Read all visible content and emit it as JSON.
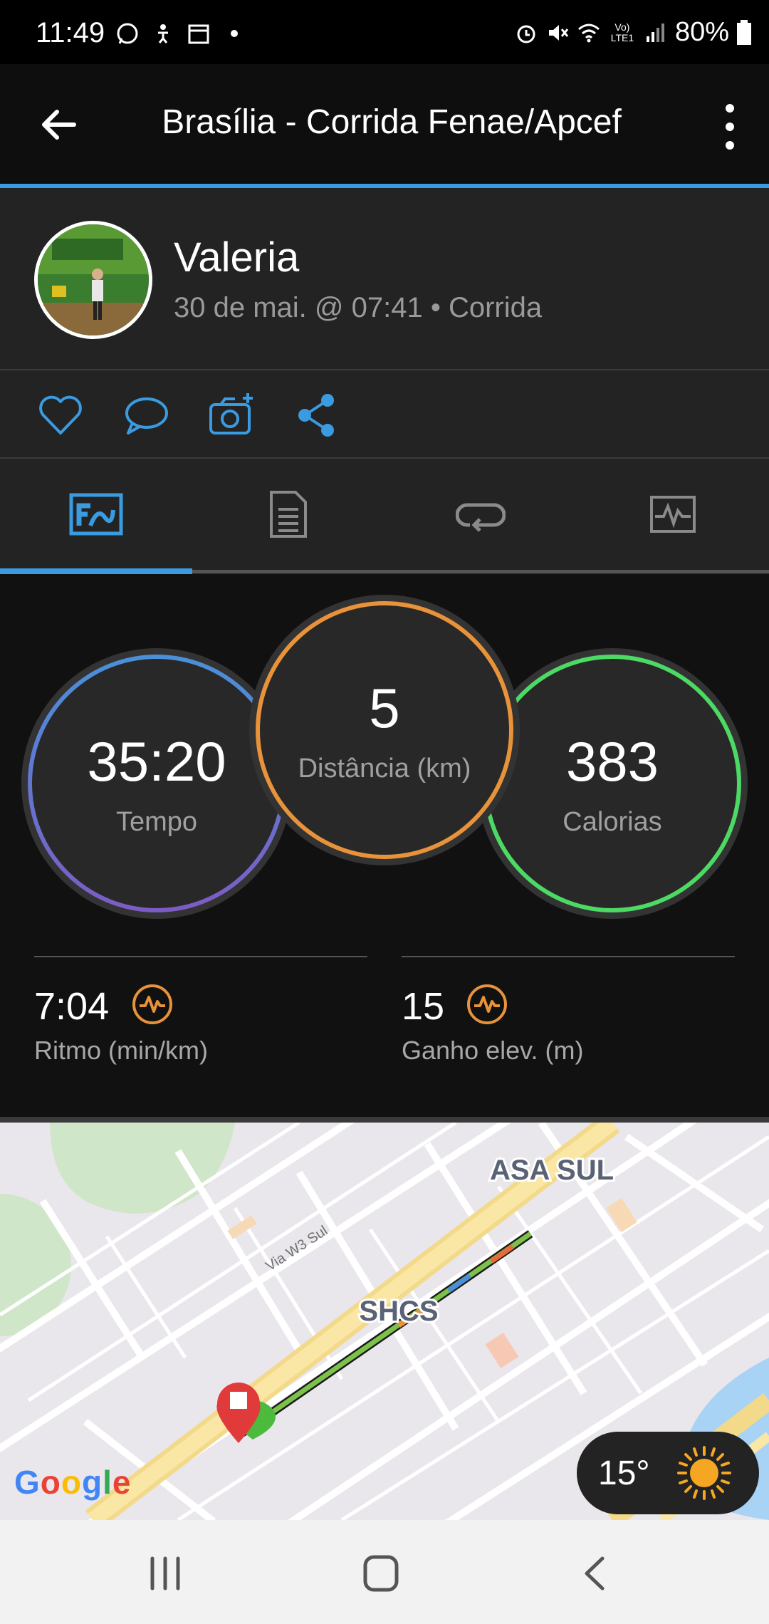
{
  "status_bar": {
    "time": "11:49",
    "battery": "80%",
    "network_label": "Vo) LTE1"
  },
  "app_bar": {
    "title": "Brasília - Corrida Fenae/Apcef"
  },
  "profile": {
    "name": "Valeria",
    "meta": "30 de mai. @ 07:41 • Corrida"
  },
  "stats": {
    "time": {
      "value": "35:20",
      "label": "Tempo"
    },
    "distance": {
      "value": "5",
      "label": "Distância (km)"
    },
    "calories": {
      "value": "383",
      "label": "Calorias"
    },
    "pace": {
      "value": "7:04",
      "label": "Ritmo (min/km)"
    },
    "elevation": {
      "value": "15",
      "label": "Ganho elev. (m)"
    }
  },
  "map": {
    "labels": {
      "asa_sul": "ASA SUL",
      "shcs": "SHCS",
      "road": "Via W3 Sul"
    },
    "google": [
      "G",
      "o",
      "o",
      "g",
      "l",
      "e"
    ]
  },
  "weather": {
    "temp": "15°"
  },
  "colors": {
    "accent": "#3a9be0",
    "time_ring_top": "#4a90d9",
    "time_ring_bottom": "#7c5cc4",
    "distance_ring": "#e8923a",
    "calories_ring": "#4cd964",
    "metric_icon": "#e8923a"
  }
}
